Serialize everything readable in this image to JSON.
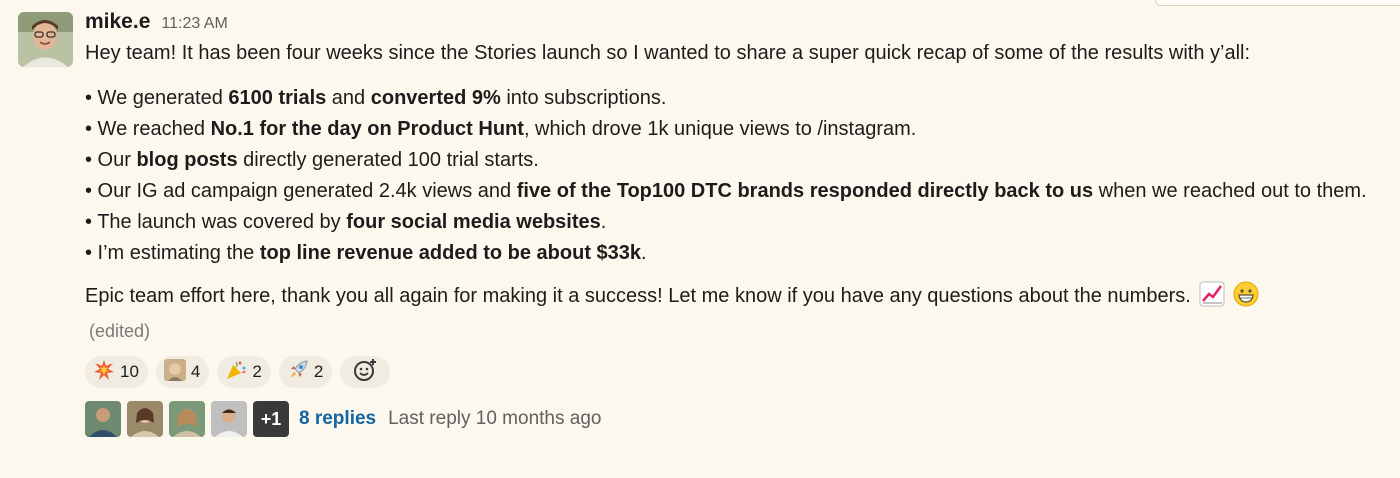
{
  "message": {
    "sender": "mike.e",
    "time": "11:23 AM",
    "intro": "Hey team! It has been four weeks since the Stories launch so I wanted to share a super quick recap of some of the results with y’all:",
    "bullets": [
      [
        "• We generated ",
        "6100 trials",
        " and ",
        "converted 9%",
        " into subscriptions."
      ],
      [
        "• We reached ",
        "No.1 for the day on Product Hunt",
        ", which drove 1k unique views to /instagram."
      ],
      [
        "• Our ",
        "blog posts",
        " directly generated 100 trial starts."
      ],
      [
        "• Our IG ad campaign generated 2.4k views and ",
        "five of the Top100 DTC brands responded directly back to us",
        " when we reached out to them."
      ],
      [
        "• The launch was covered by ",
        "four social media websites",
        "."
      ],
      [
        "• I’m estimating the ",
        "top line revenue added to be about $33k",
        "."
      ]
    ],
    "outro": "Epic team effort here, thank you all again for making it a success! Let me know if you have any questions about the numbers.",
    "outro_emojis": [
      "chart-increasing-icon",
      "grinning-face-icon"
    ],
    "edited": "(edited)"
  },
  "reactions": [
    {
      "icon": "collision-icon",
      "count": "10"
    },
    {
      "icon": "custom-face-icon",
      "count": "4"
    },
    {
      "icon": "party-popper-icon",
      "count": "2"
    },
    {
      "icon": "rocket-icon",
      "count": "2"
    }
  ],
  "thread": {
    "extra_participants": "+1",
    "replies": "8 replies",
    "last_reply": "Last reply 10 months ago"
  }
}
